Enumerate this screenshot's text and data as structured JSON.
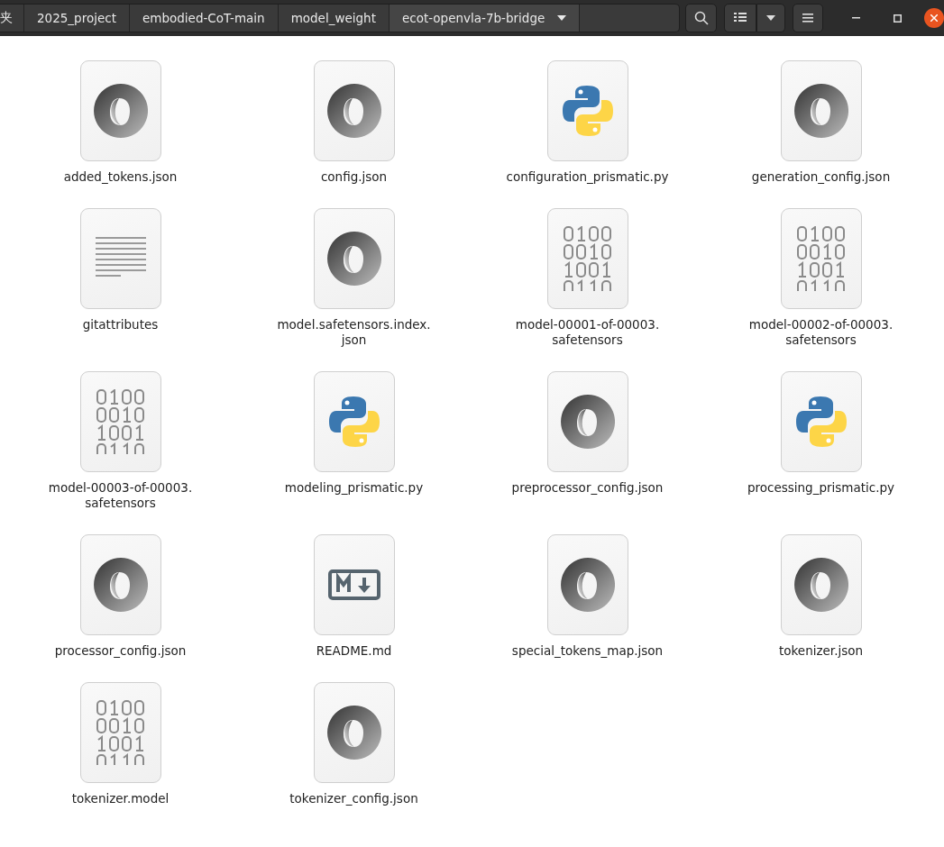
{
  "path_bar": {
    "segments": [
      {
        "label": "夹",
        "selected": false
      },
      {
        "label": "2025_project",
        "selected": false
      },
      {
        "label": "embodied-CoT-main",
        "selected": false
      },
      {
        "label": "model_weight",
        "selected": false
      },
      {
        "label": "ecot-openvla-7b-bridge",
        "selected": true
      }
    ]
  },
  "files": [
    {
      "name": "added_tokens.json",
      "kind": "json"
    },
    {
      "name": "config.json",
      "kind": "json"
    },
    {
      "name": "configuration_prismatic.py",
      "kind": "python"
    },
    {
      "name": "generation_config.json",
      "kind": "json"
    },
    {
      "name": "gitattributes",
      "kind": "text"
    },
    {
      "name": "model.safetensors.index.\njson",
      "kind": "json"
    },
    {
      "name": "model-00001-of-00003.\nsafetensors",
      "kind": "binary"
    },
    {
      "name": "model-00002-of-00003.\nsafetensors",
      "kind": "binary"
    },
    {
      "name": "model-00003-of-00003.\nsafetensors",
      "kind": "binary"
    },
    {
      "name": "modeling_prismatic.py",
      "kind": "python"
    },
    {
      "name": "preprocessor_config.json",
      "kind": "json"
    },
    {
      "name": "processing_prismatic.py",
      "kind": "python"
    },
    {
      "name": "processor_config.json",
      "kind": "json"
    },
    {
      "name": "README.md",
      "kind": "markdown"
    },
    {
      "name": "special_tokens_map.json",
      "kind": "json"
    },
    {
      "name": "tokenizer.json",
      "kind": "json"
    },
    {
      "name": "tokenizer.model",
      "kind": "binary"
    },
    {
      "name": "tokenizer_config.json",
      "kind": "json"
    }
  ]
}
